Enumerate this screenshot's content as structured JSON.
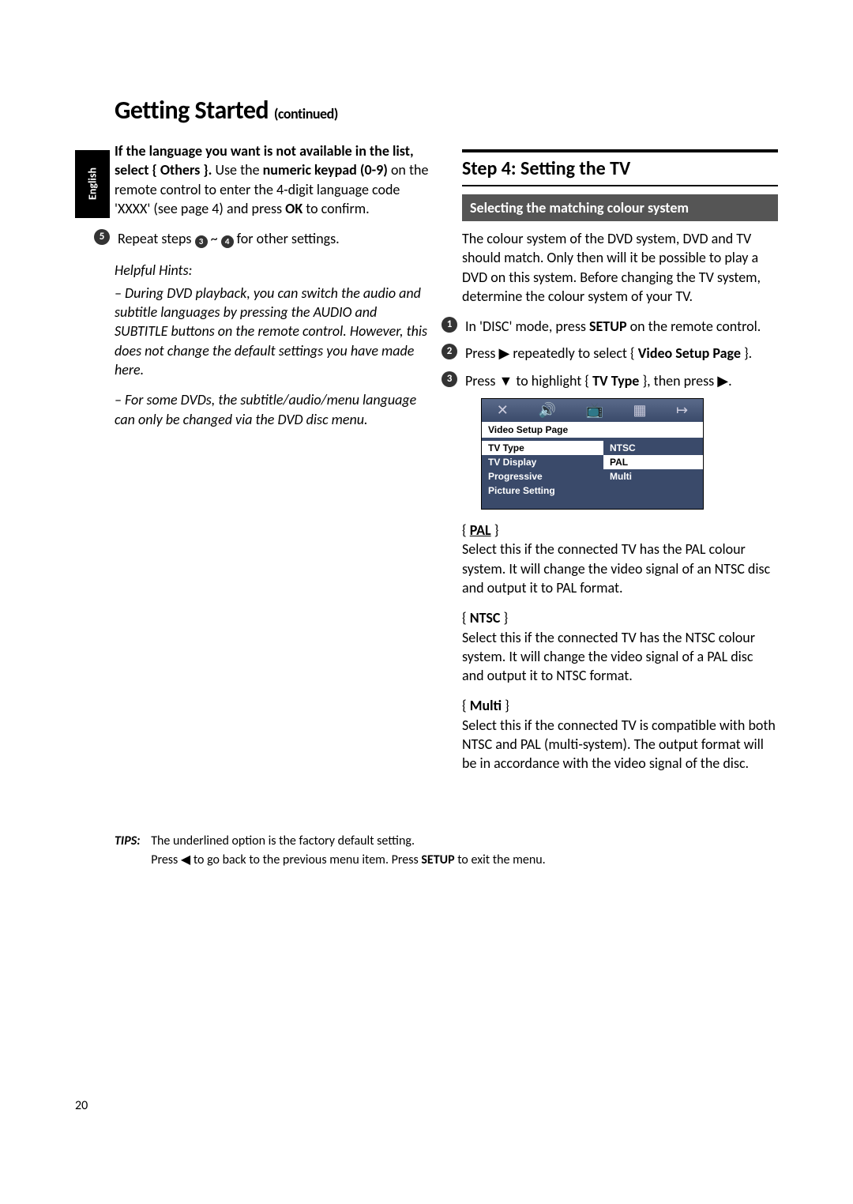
{
  "language_tab": "English",
  "title_main": "Getting Started",
  "title_continued": "(continued)",
  "left_col": {
    "others_heading": "If the language you want is not available in the list, select { Others }.",
    "others_body_1": "Use the ",
    "others_body_bold": "numeric keypad (0-9)",
    "others_body_2": " on the remote control to enter the 4-digit language code 'XXXX' (see page 4) and press ",
    "ok_bold": "OK",
    "others_body_3": " to confirm.",
    "step5": {
      "num": "5",
      "a_num": "3",
      "b_num": "4",
      "pre": "Repeat steps ",
      "mid": " ~ ",
      "post": " for other settings."
    },
    "hints_label": "Helpful Hints:",
    "hint1": "– During DVD playback, you can switch the audio and subtitle languages by pressing the AUDIO and SUBTITLE buttons on the remote control.  However, this does not change the default settings you have made here.",
    "hint2": "– For some DVDs, the subtitle/audio/menu language can only be changed via the DVD disc menu."
  },
  "right_col": {
    "step_title": "Step 4:  Setting the TV",
    "sub_head": "Selecting the matching colour system",
    "intro": "The colour system of the DVD system, DVD and TV should match. Only then will it be possible to play a DVD on this system.  Before changing the TV system, determine the colour system of your TV.",
    "s1": {
      "num": "1",
      "pre": "In 'DISC' mode, press ",
      "bold": "SETUP",
      "post": " on the remote control."
    },
    "s2": {
      "num": "2",
      "pre": "Press ",
      "arrow": "▶",
      "mid": " repeatedly to select { ",
      "bold": "Video Setup Page",
      "post": " }."
    },
    "s3": {
      "num": "3",
      "pre": "Press ",
      "arrow1": "▼",
      "mid1": " to highlight { ",
      "bold": "TV Type",
      "mid2": " }, then press ",
      "arrow2": "▶",
      "post": "."
    },
    "menu": {
      "label": "Video Setup Page",
      "left_items": [
        "TV Type",
        "TV Display",
        "Progressive",
        "Picture Setting"
      ],
      "right_items": [
        "NTSC",
        "PAL",
        "Multi"
      ],
      "selected_left": 0,
      "selected_right": 1
    },
    "pal_label": "PAL",
    "pal_body": "Select this if the connected TV has the PAL colour system. It will change the video signal of an NTSC disc and output it to PAL format.",
    "ntsc_label": "NTSC",
    "ntsc_body": "Select this if the connected TV has the NTSC colour system. It will change the video signal of a PAL disc and output it to NTSC format.",
    "multi_label": "Multi",
    "multi_body": "Select this if the connected TV is compatible with both NTSC and PAL (multi-system).  The output format will be in accordance with the video signal of the disc."
  },
  "tips": {
    "label": "TIPS:",
    "line1": "The underlined option is the factory default setting.",
    "line2_pre": "Press ",
    "line2_arrow": "◀",
    "line2_mid": " to go back to the previous menu item.  Press ",
    "line2_bold": "SETUP",
    "line2_post": " to exit the menu."
  },
  "page_number": "20"
}
